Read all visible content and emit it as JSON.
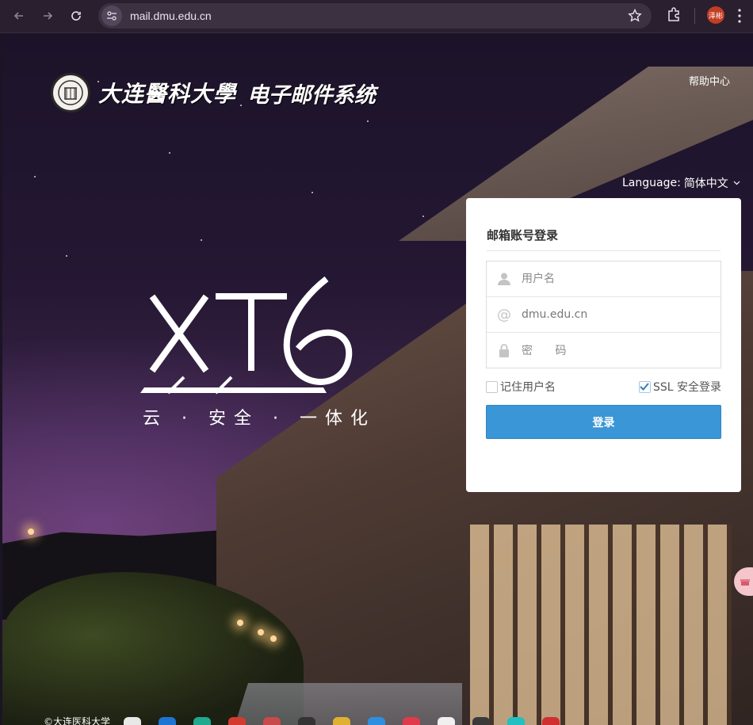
{
  "browser": {
    "url": "mail.dmu.edu.cn",
    "profile_initials": "泽彬"
  },
  "header": {
    "university_name": "大连醫科大學",
    "system_name": "电子邮件系统",
    "help_label": "帮助中心",
    "language_label": "Language:",
    "language_value": "简体中文"
  },
  "hero": {
    "product_mark": "XT6",
    "tagline": "云 · 安全 · 一体化"
  },
  "login": {
    "title": "邮箱账号登录",
    "username_placeholder": "用户名",
    "domain_value": "dmu.edu.cn",
    "password_placeholder": "密 码",
    "remember_label": "记住用户名",
    "remember_checked": false,
    "ssl_label": "SSL 安全登录",
    "ssl_checked": true,
    "submit_label": "登录"
  },
  "footer": {
    "copyright": "©大连医科大学"
  },
  "colors": {
    "primary_button": "#3a96d6",
    "chrome_bg": "#2a1f2e",
    "panel_bg": "#ffffff"
  },
  "icons": [
    "back-arrow-icon",
    "forward-arrow-icon",
    "reload-icon",
    "site-info-icon",
    "star-icon",
    "extensions-icon",
    "user-icon",
    "at-sign-icon",
    "lock-icon",
    "checkmark-icon",
    "chevron-down-icon"
  ]
}
